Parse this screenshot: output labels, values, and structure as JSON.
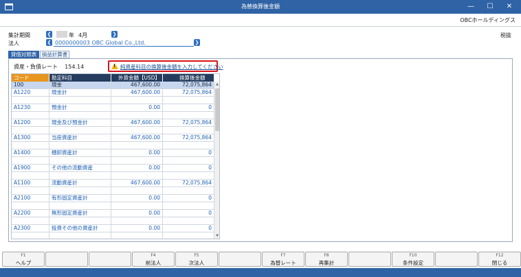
{
  "window": {
    "title": "為替換算後金額",
    "min": "—",
    "max": "☐",
    "close": "✕"
  },
  "company": "OBCホールディングス",
  "tax": "税抜",
  "period": {
    "label": "集計期間",
    "year_suffix": "年",
    "month": "4月"
  },
  "corp": {
    "label": "法人",
    "value": "0000000003 OBC Global Co.,Ltd."
  },
  "tabs": [
    "貸借対照表",
    "損益計算書"
  ],
  "rate": {
    "label": "資産・負債レート",
    "value": "154.14"
  },
  "warning": "純資産科目の換算後金額を入力してください",
  "grid": {
    "headers": [
      "コード",
      "勘定科目",
      "外貨金額【USD】",
      "換算後金額"
    ],
    "rows": [
      {
        "code": "100",
        "name": "現金",
        "amount": "467,600.00",
        "converted": "72,075,864"
      },
      {
        "code": "A1220",
        "name": "現金計",
        "amount": "467,600.00",
        "converted": "72,075,864"
      },
      {
        "code": "",
        "name": "",
        "amount": "",
        "converted": ""
      },
      {
        "code": "A1230",
        "name": "預金計",
        "amount": "0.00",
        "converted": "0"
      },
      {
        "code": "",
        "name": "",
        "amount": "",
        "converted": ""
      },
      {
        "code": "A1200",
        "name": "現金及び預金計",
        "amount": "467,600.00",
        "converted": "72,075,864"
      },
      {
        "code": "",
        "name": "",
        "amount": "",
        "converted": ""
      },
      {
        "code": "A1300",
        "name": "当座資産計",
        "amount": "467,600.00",
        "converted": "72,075,864"
      },
      {
        "code": "",
        "name": "",
        "amount": "",
        "converted": ""
      },
      {
        "code": "A1400",
        "name": "棚卸資産計",
        "amount": "0.00",
        "converted": "0"
      },
      {
        "code": "",
        "name": "",
        "amount": "",
        "converted": ""
      },
      {
        "code": "A1900",
        "name": "その他の流動資産",
        "amount": "0.00",
        "converted": "0"
      },
      {
        "code": "",
        "name": "",
        "amount": "",
        "converted": ""
      },
      {
        "code": "A1100",
        "name": "流動資産計",
        "amount": "467,600.00",
        "converted": "72,075,864"
      },
      {
        "code": "",
        "name": "",
        "amount": "",
        "converted": ""
      },
      {
        "code": "A2100",
        "name": "有形固定資産計",
        "amount": "0.00",
        "converted": "0"
      },
      {
        "code": "",
        "name": "",
        "amount": "",
        "converted": ""
      },
      {
        "code": "A2200",
        "name": "無形固定資産計",
        "amount": "0.00",
        "converted": "0"
      },
      {
        "code": "",
        "name": "",
        "amount": "",
        "converted": ""
      },
      {
        "code": "A2300",
        "name": "投資その他の資産計",
        "amount": "0.00",
        "converted": "0"
      },
      {
        "code": "",
        "name": "",
        "amount": "",
        "converted": ""
      }
    ]
  },
  "fkeys": [
    {
      "key": "F1",
      "label": "ヘルプ"
    },
    {
      "key": "",
      "label": ""
    },
    {
      "key": "",
      "label": ""
    },
    {
      "key": "F4",
      "label": "前法人"
    },
    {
      "key": "F5",
      "label": "次法人"
    },
    {
      "key": "",
      "label": ""
    },
    {
      "key": "F7",
      "label": "為替レート"
    },
    {
      "key": "F8",
      "label": "再集計"
    },
    {
      "key": "",
      "label": ""
    },
    {
      "key": "F10",
      "label": "条件設定"
    },
    {
      "key": "",
      "label": ""
    },
    {
      "key": "F12",
      "label": "閉じる"
    }
  ],
  "colors": {
    "accent": "#2f63a6",
    "warning_border": "#d8141a",
    "code_header": "#e8961e"
  }
}
